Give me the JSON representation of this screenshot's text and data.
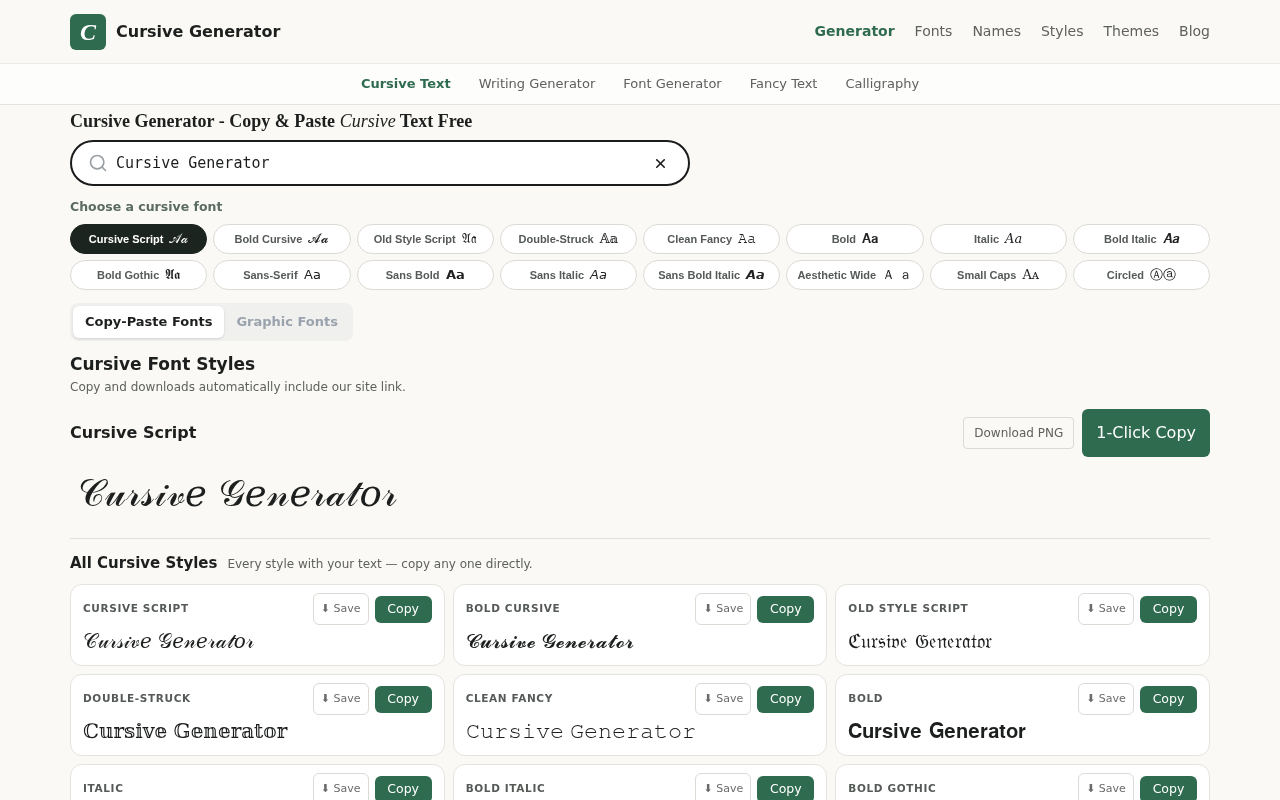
{
  "header": {
    "logo_letter": "C",
    "site_name": "Cursive Generator",
    "nav": [
      {
        "label": "Generator",
        "selected": true
      },
      {
        "label": "Fonts",
        "selected": false
      },
      {
        "label": "Names",
        "selected": false
      },
      {
        "label": "Styles",
        "selected": false
      },
      {
        "label": "Themes",
        "selected": false
      },
      {
        "label": "Blog",
        "selected": false
      }
    ]
  },
  "subnav": [
    {
      "label": "Cursive Text",
      "selected": true
    },
    {
      "label": "Writing Generator",
      "selected": false
    },
    {
      "label": "Font Generator",
      "selected": false
    },
    {
      "label": "Fancy Text",
      "selected": false
    },
    {
      "label": "Calligraphy",
      "selected": false
    }
  ],
  "page_title": "Cursive Generator - Copy & Paste *Cursive* Text Free",
  "search": {
    "value": "Cursive Generator"
  },
  "font_picker": {
    "label": "Choose a cursive font",
    "fonts": [
      {
        "name": "Cursive Script",
        "sample": "𝒜𝒶",
        "selected": true
      },
      {
        "name": "Bold Cursive",
        "sample": "𝓐𝓪",
        "selected": false
      },
      {
        "name": "Old Style Script",
        "sample": "𝔄𝔞",
        "selected": false
      },
      {
        "name": "Double-Struck",
        "sample": "𝔸𝕒",
        "selected": false
      },
      {
        "name": "Clean Fancy",
        "sample": "𝙰𝚊",
        "selected": false
      },
      {
        "name": "Bold",
        "sample": "𝐀𝐚",
        "selected": false
      },
      {
        "name": "Italic",
        "sample": "𝐴𝑎",
        "selected": false
      },
      {
        "name": "Bold Italic",
        "sample": "𝑨𝒂",
        "selected": false
      },
      {
        "name": "Bold Gothic",
        "sample": "𝕬𝖆",
        "selected": false
      },
      {
        "name": "Sans-Serif",
        "sample": "𝖠𝖺",
        "selected": false
      },
      {
        "name": "Sans Bold",
        "sample": "𝗔𝗮",
        "selected": false
      },
      {
        "name": "Sans Italic",
        "sample": "𝘈𝘢",
        "selected": false
      },
      {
        "name": "Sans Bold Italic",
        "sample": "𝘼𝙖",
        "selected": false
      },
      {
        "name": "Aesthetic Wide",
        "sample": "Ａ ａ",
        "selected": false
      },
      {
        "name": "Small Caps",
        "sample": "Aᴀ",
        "selected": false
      },
      {
        "name": "Circled",
        "sample": "Ⓐⓐ",
        "selected": false
      }
    ]
  },
  "mode_tabs": [
    {
      "label": "Copy-Paste Fonts",
      "selected": true
    },
    {
      "label": "Graphic Fonts",
      "selected": false
    }
  ],
  "styles_section": {
    "title": "Cursive Font Styles",
    "subtitle": "Copy and downloads automatically include our site link."
  },
  "preview": {
    "font_name": "Cursive Script",
    "download_label": "Download PNG",
    "copy_label": "1-Click Copy",
    "text": "𝒞𝓊𝓇𝓈𝒾𝓋𝑒 𝒢𝑒𝓃𝑒𝓇𝒶𝓉𝑜𝓇"
  },
  "all_styles": {
    "title": "All Cursive Styles",
    "subtitle": "Every style with your text — copy any one directly.",
    "cards": [
      {
        "label": "CURSIVE SCRIPT",
        "save_label": "⬇ Save",
        "copy_label": "Copy",
        "text": "𝒞𝓊𝓇𝓈𝒾𝓋𝑒 𝒢𝑒𝓃𝑒𝓇𝒶𝓉𝑜𝓇"
      },
      {
        "label": "BOLD CURSIVE",
        "save_label": "⬇ Save",
        "copy_label": "Copy",
        "text": "𝓒𝓾𝓻𝓼𝓲𝓿𝓮 𝓖𝓮𝓷𝓮𝓻𝓪𝓽𝓸𝓻"
      },
      {
        "label": "OLD STYLE SCRIPT",
        "save_label": "⬇ Save",
        "copy_label": "Copy",
        "text": "ℭ𝔲𝔯𝔰𝔦𝔳𝔢 𝔊𝔢𝔫𝔢𝔯𝔞𝔱𝔬𝔯"
      },
      {
        "label": "DOUBLE-STRUCK",
        "save_label": "⬇ Save",
        "copy_label": "Copy",
        "text": "ℂ𝕦𝕣𝕤𝕚𝕧𝕖 𝔾𝕖𝕟𝕖𝕣𝕒𝕥𝕠𝕣"
      },
      {
        "label": "CLEAN FANCY",
        "save_label": "⬇ Save",
        "copy_label": "Copy",
        "text": "𝙲𝚞𝚛𝚜𝚒𝚟𝚎 𝙶𝚎𝚗𝚎𝚛𝚊𝚝𝚘𝚛"
      },
      {
        "label": "BOLD",
        "save_label": "⬇ Save",
        "copy_label": "Copy",
        "text": "𝐂𝐮𝐫𝐬𝐢𝐯𝐞 𝐆𝐞𝐧𝐞𝐫𝐚𝐭𝐨𝐫"
      },
      {
        "label": "ITALIC",
        "save_label": "⬇ Save",
        "copy_label": "Copy"
      },
      {
        "label": "BOLD ITALIC",
        "save_label": "⬇ Save",
        "copy_label": "Copy"
      },
      {
        "label": "BOLD GOTHIC",
        "save_label": "⬇ Save",
        "copy_label": "Copy"
      }
    ]
  }
}
